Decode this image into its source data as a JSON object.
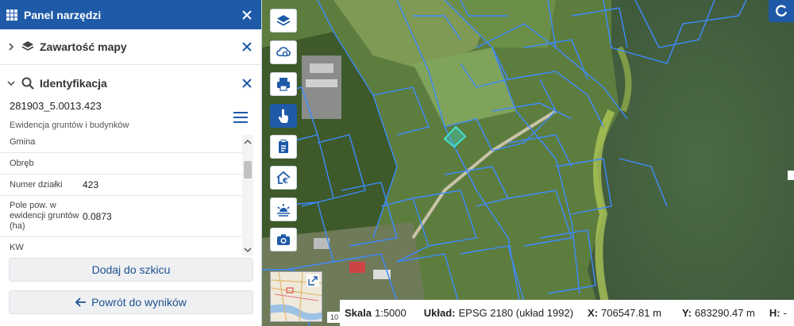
{
  "panel": {
    "title": "Panel narzędzi",
    "sections": [
      {
        "title": "Zawartość mapy",
        "icon": "layers-icon",
        "expanded": false
      },
      {
        "title": "Identyfikacja",
        "icon": "search-icon",
        "expanded": true
      }
    ]
  },
  "identification": {
    "id": "281903_5.0013.423",
    "subtitle": "Ewidencja gruntów i budynków",
    "rows": [
      {
        "label": "Gmina",
        "value": ""
      },
      {
        "label": "Obręb",
        "value": ""
      },
      {
        "label": "Numer działki",
        "value": "423"
      },
      {
        "label": "Pole pow. w ewidencji gruntów (ha)",
        "value": "0.0873"
      },
      {
        "label": "KW",
        "value": ""
      }
    ]
  },
  "buttons": {
    "add_to_sketch": "Dodaj do szkicu",
    "back_to_results": "Powrót do wyników"
  },
  "toolbar": [
    {
      "name": "layers-icon",
      "active": false
    },
    {
      "name": "cloud-layers-icon",
      "active": false
    },
    {
      "name": "print-icon",
      "active": false
    },
    {
      "name": "hand-pointer-icon",
      "active": true
    },
    {
      "name": "clipboard-icon",
      "active": false
    },
    {
      "name": "home-euro-icon",
      "active": false
    },
    {
      "name": "sunrise-icon",
      "active": false
    },
    {
      "name": "camera-icon",
      "active": false
    }
  ],
  "status": {
    "scale_label": "Skala",
    "scale_value": "1:5000",
    "crs_label": "Układ:",
    "crs_value": "EPSG 2180 (układ 1992)",
    "x_label": "X:",
    "x_value": "706547.81 m",
    "y_label": "Y:",
    "y_value": "683290.47 m",
    "h_label": "H:",
    "h_value": "-"
  },
  "scalebar_text": "10",
  "colors": {
    "brand": "#1e5aa8",
    "parcel_line": "#3d8bff",
    "selected_parcel": "#40e0d0"
  }
}
